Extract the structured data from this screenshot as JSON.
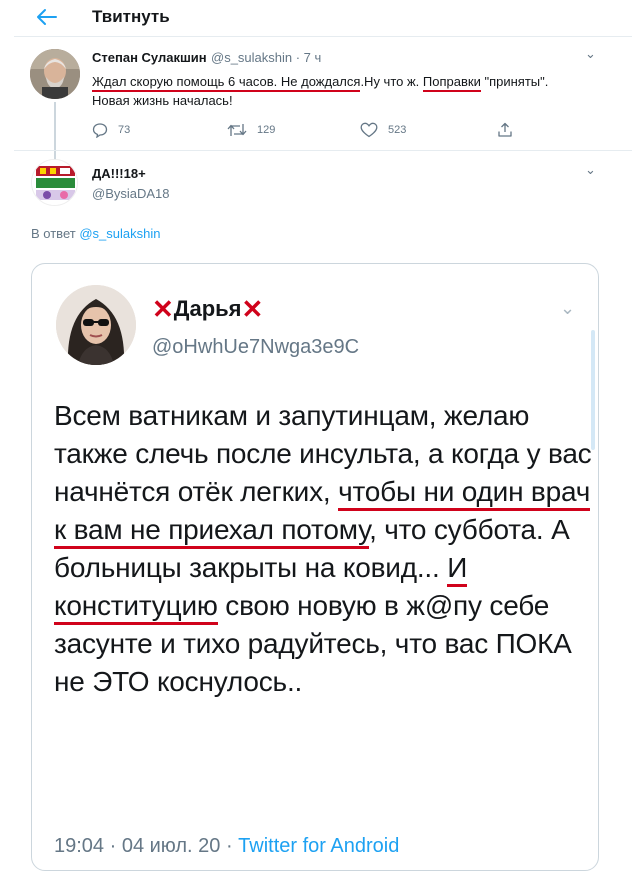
{
  "header": {
    "title": "Твитнуть",
    "back_label": "←"
  },
  "tweet1": {
    "author_name": "Степан Сулакшин",
    "handle_time": "@s_sulakshin · 7 ч",
    "text_part1": "Ждал скорую помощь 6 часов. Не дождался",
    "text_part2": ".Ну что ж. ",
    "text_part3": "Поправки",
    "text_part4": " \"приняты\". Новая жизнь началась!",
    "replies": "73",
    "retweets": "129",
    "likes": "523",
    "caret": "⌄"
  },
  "tweet2": {
    "author_name": "ДА!!!18+",
    "handle": "@BysiaDA18",
    "caret": "⌄",
    "reply_prefix": "В ответ ",
    "reply_handle": "@s_sulakshin"
  },
  "embedded": {
    "author_name": "Дарья",
    "handle": "@oHwhUe7Nwga3e9C",
    "caret": "⌄",
    "x_mark": "✕",
    "text_a": "Всем ватникам и запутинцам, желаю также слечь после инсульта, а когда у вас начнётся отёк легких, ",
    "text_b": "чтобы ни один врач к вам не приехал потому",
    "text_c": ", что суббота. А больницы закрыты на ковид... ",
    "text_d": "И конституцию",
    "text_e": " свою новую в ж@пу себе засунте и тихо радуйтесь, что вас ПОКА не ЭТО коснулось..",
    "footer_time": "19:04 · 04 июл. 20 · ",
    "footer_source": "Twitter for Android"
  },
  "colors": {
    "accent": "#1da1f2",
    "underline": "#d0021b",
    "muted": "#657786"
  }
}
